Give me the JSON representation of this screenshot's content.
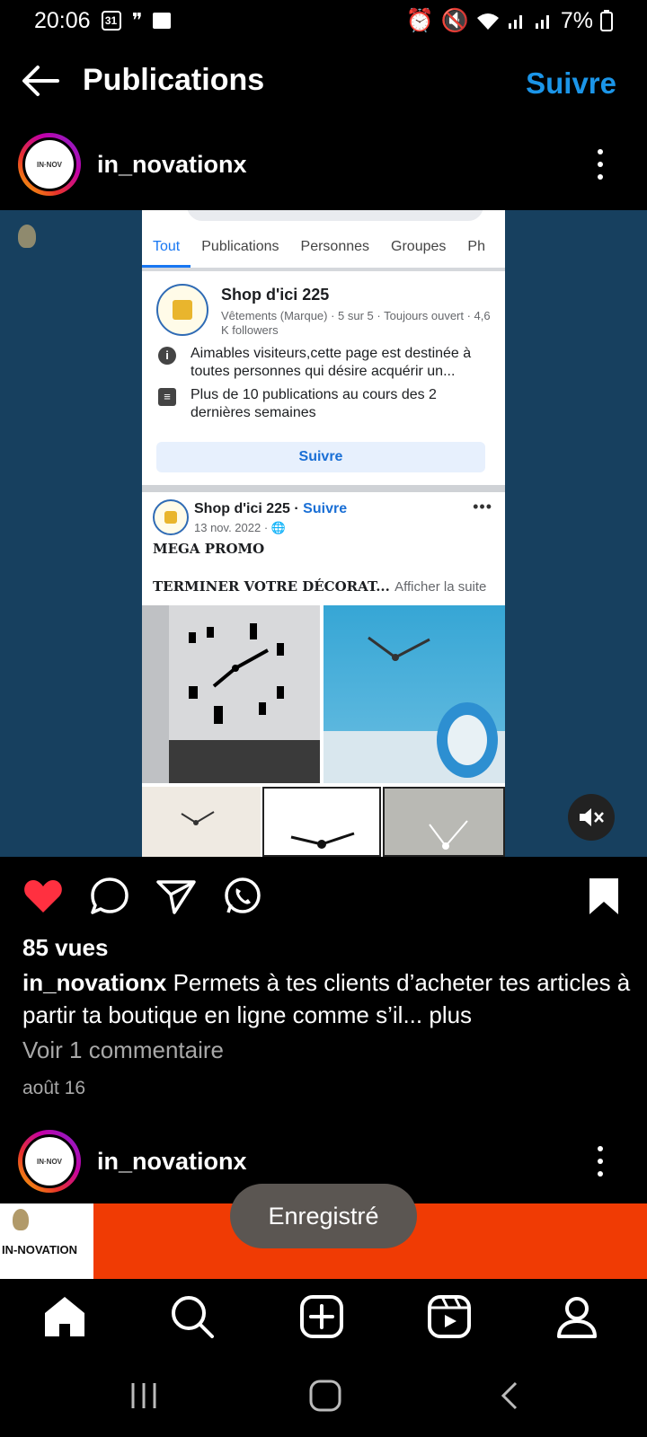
{
  "status_bar": {
    "time": "20:06",
    "calendar_icon_text": "31",
    "battery": "7%"
  },
  "header": {
    "back_icon": "arrow-left-icon",
    "title": "Publications",
    "follow_label": "Suivre"
  },
  "post": {
    "username": "in_novationx",
    "media": {
      "tabs": [
        "Tout",
        "Publications",
        "Personnes",
        "Groupes",
        "Ph"
      ],
      "page_name": "Shop d'ici 225",
      "page_meta": "Vêtements (Marque) · 5 sur 5 · Toujours ouvert · 4,6 K followers",
      "info_1": "Aimables visiteurs,cette page est destinée à toutes personnes qui désire acquérir un...",
      "info_2": "Plus de 10 publications au cours des 2 dernières semaines",
      "follow_button": "Suivre",
      "post_author": "Shop d'ici 225",
      "post_follow": "Suivre",
      "post_date": "13 nov. 2022 ·",
      "promo_title": "MEGA PROMO",
      "promo_text": "TERMINER VOTRE DÉCORAT...",
      "see_more": "Afficher la suite"
    },
    "views": "85 vues",
    "caption_user": "in_novationx",
    "caption_text": "Permets à tes clients d’acheter tes articles à partir ta boutique en ligne comme s’il...",
    "caption_more": "plus",
    "comments_link": "Voir 1 commentaire",
    "date": "août 16",
    "liked": true,
    "saved": true
  },
  "next_post": {
    "username": "in_novationx",
    "logo_text": "IN-NOVATION"
  },
  "toast": "Enregistré",
  "watermark": "IN-NOVATION",
  "colors": {
    "accent": "#1b95e8",
    "like": "#ff3040",
    "media_bg": "#17405f",
    "next_media_bg": "#f03b04"
  }
}
